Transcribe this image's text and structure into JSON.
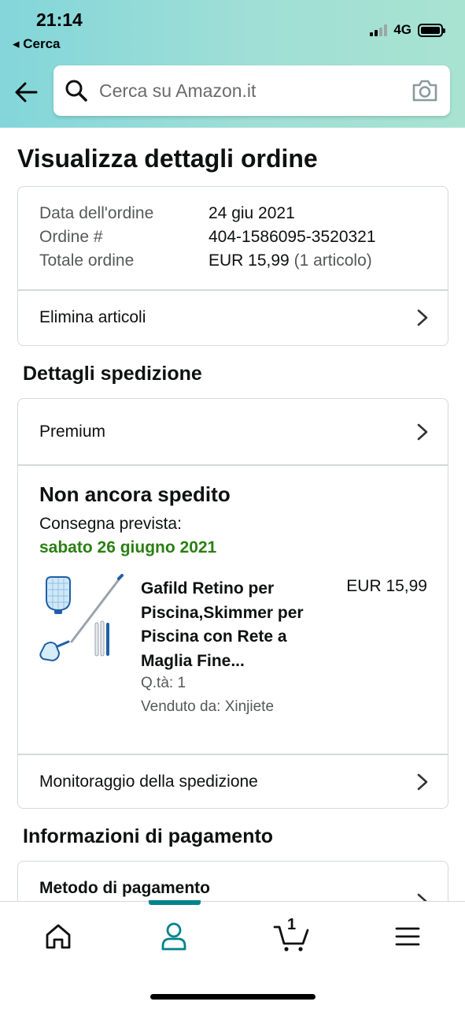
{
  "status_bar": {
    "time": "21:14",
    "back_app": "◂ Cerca",
    "network": "4G",
    "battery_level": 1.0
  },
  "search": {
    "placeholder": "Cerca su Amazon.it"
  },
  "page": {
    "title": "Visualizza dettagli ordine"
  },
  "order_summary": {
    "date_label": "Data dell'ordine",
    "date_value": "24 giu 2021",
    "number_label": "Ordine #",
    "number_value": "404-1586095-3520321",
    "total_label": "Totale ordine",
    "total_value": "EUR 15,99",
    "total_items": "(1 articolo)",
    "delete_link": "Elimina articoli"
  },
  "shipping": {
    "section_title": "Dettagli spedizione",
    "service": "Premium",
    "status": "Non ancora spedito",
    "estimate_label": "Consegna prevista:",
    "estimate_date": "sabato 26 giugno 2021",
    "status_color": "#2a7f12",
    "product": {
      "title": "Gafild Retino per Piscina,Skimmer per Piscina con Rete a Maglia Fine...",
      "price": "EUR 15,99",
      "quantity": "Q.tà: 1",
      "seller": "Venduto da: Xinjiete"
    },
    "tracking_link": "Monitoraggio della spedizione"
  },
  "payment": {
    "section_title": "Informazioni di pagamento",
    "method_label": "Metodo di pagamento"
  },
  "bottom_nav": {
    "active": "account",
    "cart_count": "1",
    "accent_color": "#00838a"
  }
}
